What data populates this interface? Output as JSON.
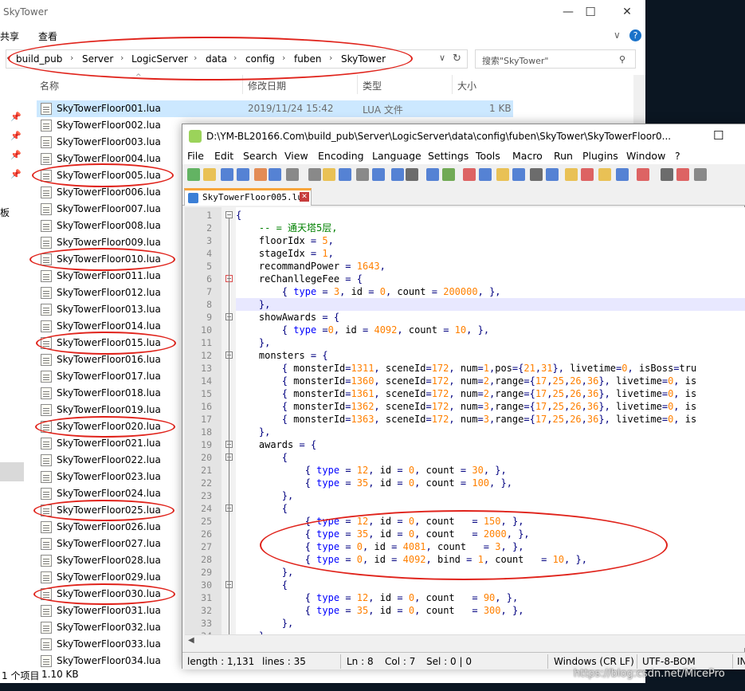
{
  "explorer": {
    "title": "SkyTower",
    "ribbon": [
      "共享",
      "查看"
    ],
    "breadcrumb": [
      "build_pub",
      "Server",
      "LogicServer",
      "data",
      "config",
      "fuben",
      "SkyTower"
    ],
    "search_placeholder": "搜索\"SkyTower\"",
    "columns": {
      "name": "名称",
      "date": "修改日期",
      "type": "类型",
      "size": "大小"
    },
    "files": [
      {
        "name": "SkyTowerFloor001.lua",
        "date": "2019/11/24 15:42",
        "type": "LUA 文件",
        "size": "1 KB"
      },
      {
        "name": "SkyTowerFloor002.lua"
      },
      {
        "name": "SkyTowerFloor003.lua"
      },
      {
        "name": "SkyTowerFloor004.lua"
      },
      {
        "name": "SkyTowerFloor005.lua"
      },
      {
        "name": "SkyTowerFloor006.lua"
      },
      {
        "name": "SkyTowerFloor007.lua"
      },
      {
        "name": "SkyTowerFloor008.lua"
      },
      {
        "name": "SkyTowerFloor009.lua"
      },
      {
        "name": "SkyTowerFloor010.lua"
      },
      {
        "name": "SkyTowerFloor011.lua"
      },
      {
        "name": "SkyTowerFloor012.lua"
      },
      {
        "name": "SkyTowerFloor013.lua"
      },
      {
        "name": "SkyTowerFloor014.lua"
      },
      {
        "name": "SkyTowerFloor015.lua"
      },
      {
        "name": "SkyTowerFloor016.lua"
      },
      {
        "name": "SkyTowerFloor017.lua"
      },
      {
        "name": "SkyTowerFloor018.lua"
      },
      {
        "name": "SkyTowerFloor019.lua"
      },
      {
        "name": "SkyTowerFloor020.lua"
      },
      {
        "name": "SkyTowerFloor021.lua"
      },
      {
        "name": "SkyTowerFloor022.lua"
      },
      {
        "name": "SkyTowerFloor023.lua"
      },
      {
        "name": "SkyTowerFloor024.lua"
      },
      {
        "name": "SkyTowerFloor025.lua"
      },
      {
        "name": "SkyTowerFloor026.lua"
      },
      {
        "name": "SkyTowerFloor027.lua"
      },
      {
        "name": "SkyTowerFloor028.lua"
      },
      {
        "name": "SkyTowerFloor029.lua"
      },
      {
        "name": "SkyTowerFloor030.lua"
      },
      {
        "name": "SkyTowerFloor031.lua"
      },
      {
        "name": "SkyTowerFloor032.lua"
      },
      {
        "name": "SkyTowerFloor033.lua"
      },
      {
        "name": "SkyTowerFloor034.lua"
      }
    ],
    "nav_stub": "板",
    "status": {
      "count": "1 个项目",
      "size": "1.10 KB"
    }
  },
  "npp": {
    "title": "D:\\YM-BL20166.Com\\build_pub\\Server\\LogicServer\\data\\config\\fuben\\SkyTower\\SkyTowerFloor0...",
    "menu": [
      "File",
      "Edit",
      "Search",
      "View",
      "Encoding",
      "Language",
      "Settings",
      "Tools",
      "Macro",
      "Run",
      "Plugins",
      "Window",
      "?"
    ],
    "tab": "SkyTowerFloor005.lua",
    "status": {
      "length": "length : 1,131",
      "lines": "lines : 35",
      "ln": "Ln : 8",
      "col": "Col : 7",
      "sel": "Sel : 0 | 0",
      "eol": "Windows (CR LF)",
      "enc": "UTF-8-BOM",
      "mode": "IN"
    }
  },
  "code": [
    "{",
    "    -- = 通天塔5层,",
    "    floorIdx = 5,",
    "    stageIdx = 1,",
    "    recommandPower = 1643,",
    "    reChanllegeFee = {",
    "        { type = 3, id = 0, count = 200000, },",
    "    },",
    "    showAwards = {",
    "        { type =0, id = 4092, count = 10, },",
    "    },",
    "    monsters = {",
    "        { monsterId=1311, sceneId=172, num=1,pos={21,31}, livetime=0, isBoss=tru",
    "        { monsterId=1360, sceneId=172, num=2,range={17,25,26,36}, livetime=0, is",
    "        { monsterId=1361, sceneId=172, num=2,range={17,25,26,36}, livetime=0, is",
    "        { monsterId=1362, sceneId=172, num=3,range={17,25,26,36}, livetime=0, is",
    "        { monsterId=1363, sceneId=172, num=3,range={17,25,26,36}, livetime=0, is",
    "    },",
    "    awards = {",
    "        {",
    "            { type = 12, id = 0, count = 30, },",
    "            { type = 35, id = 0, count = 100, },",
    "        },",
    "        {",
    "            { type = 12, id = 0, count   = 150, },",
    "            { type = 35, id = 0, count   = 2000, },",
    "            { type = 0, id = 4081, count   = 3, },",
    "            { type = 0, id = 4092, bind = 1, count   = 10, },",
    "        },",
    "        {",
    "            { type = 12, id = 0, count   = 90, },",
    "            { type = 35, id = 0, count   = 300, },",
    "        },",
    "    }"
  ],
  "watermark": "https://blog.csdn.net/MicePro",
  "colors": {
    "annotation": "#e0231b",
    "selection": "#cce8ff",
    "keyword": "#0000ff",
    "number": "#ff8000",
    "comment": "#008000"
  }
}
